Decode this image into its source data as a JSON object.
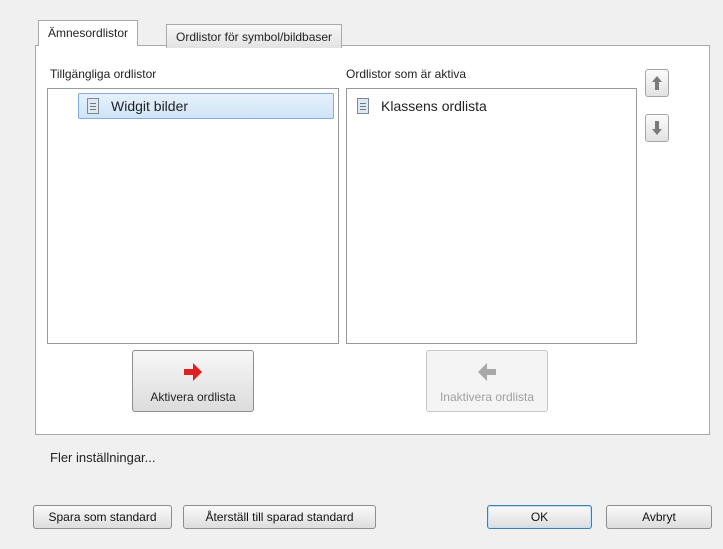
{
  "tabs": [
    {
      "label": "Ämnesordlistor",
      "active": true
    },
    {
      "label": "Ordlistor för symbol/bildbaser",
      "active": false
    }
  ],
  "available": {
    "heading": "Tillgängliga ordlistor",
    "items": [
      {
        "label": "Widgit bilder",
        "icon": "dictionary-icon",
        "selected": true
      }
    ]
  },
  "active": {
    "heading": "Ordlistor som är aktiva",
    "items": [
      {
        "label": "Klassens ordlista",
        "icon": "dictionary-icon",
        "selected": false
      }
    ]
  },
  "move_up_icon": "arrow-up-icon",
  "move_down_icon": "arrow-down-icon",
  "activate_button": {
    "label": "Aktivera ordlista",
    "icon": "arrow-right-icon",
    "icon_color": "#e02020",
    "enabled": true
  },
  "deactivate_button": {
    "label": "Inaktivera ordlista",
    "icon": "arrow-left-icon",
    "icon_color": "#a8a8a8",
    "enabled": false
  },
  "more_settings": "Fler inställningar...",
  "footer": {
    "save_default": "Spara som standard",
    "restore_default": "Återställ till sparad standard",
    "ok": "OK",
    "cancel": "Avbryt"
  }
}
